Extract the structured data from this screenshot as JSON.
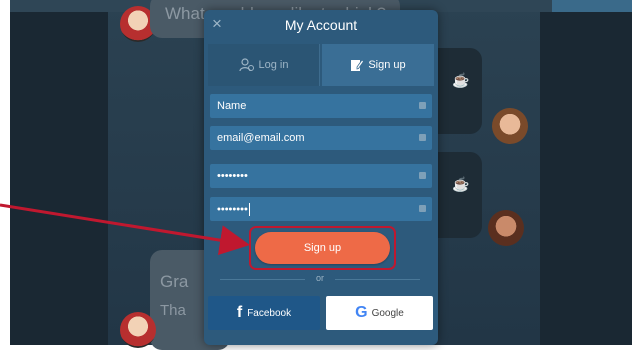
{
  "modal": {
    "title": "My Account",
    "close_glyph": "×"
  },
  "tabs": {
    "login_label": "Log in",
    "signup_label": "Sign up",
    "login_icon": "user-icon",
    "signup_icon": "edit-icon"
  },
  "fields": [
    {
      "value": "Name",
      "icon": "keyboard-icon"
    },
    {
      "value": "email@email.com",
      "icon": "keyboard-icon"
    },
    {
      "value": "••••••••",
      "icon": "keyboard-icon"
    },
    {
      "value": "••••••••",
      "icon": "keyboard-icon"
    }
  ],
  "signup_button": {
    "label": "Sign up"
  },
  "divider": {
    "label": "or"
  },
  "social": {
    "facebook_label": "Facebook",
    "facebook_glyph": "f",
    "google_label": "Google",
    "google_glyph": "G"
  },
  "background_chat": {
    "bubble_top_text": "What would you like to drink?",
    "bubble_bottom_line1": "Gra",
    "bubble_bottom_line2": "Tha"
  },
  "annotation": {
    "color": "#c0182f"
  },
  "colors": {
    "modal_bg": "#2d5a7c",
    "field_bg": "#36739f",
    "signup_accent": "#ee6a47",
    "facebook_blue": "#1f5788"
  }
}
